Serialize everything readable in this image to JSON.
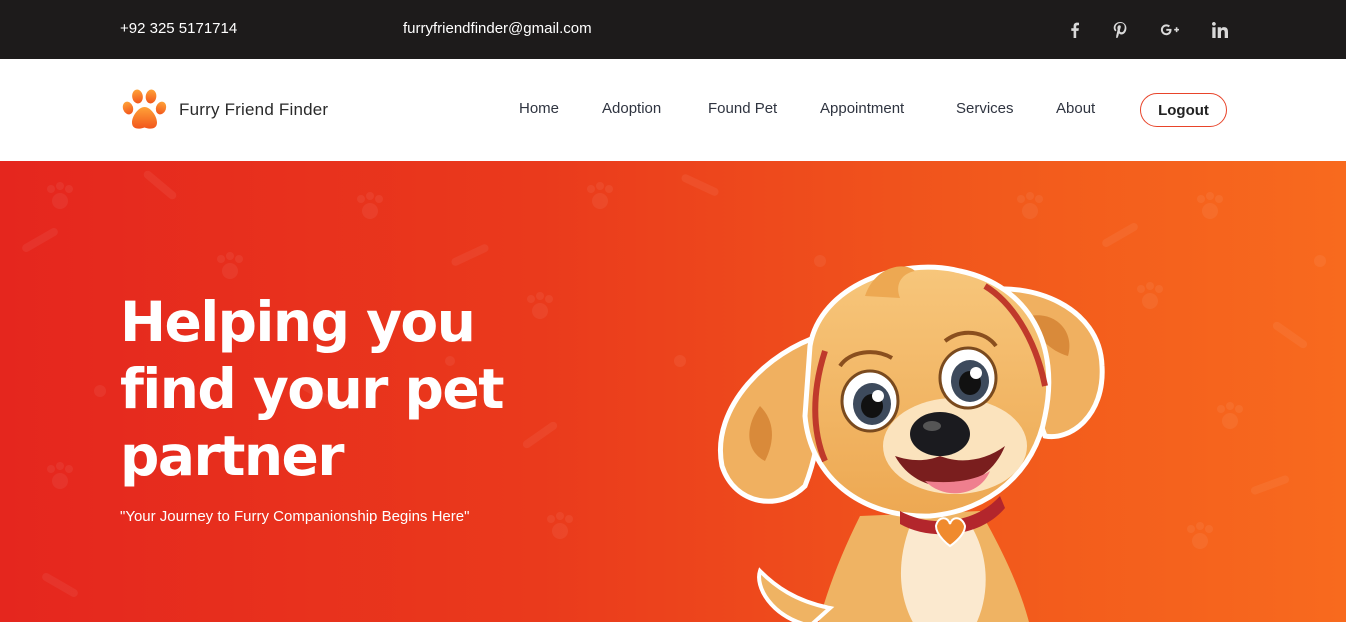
{
  "topbar": {
    "phone": "+92 325 5171714",
    "email": "furryfriendfinder@gmail.com",
    "social": [
      "facebook-icon",
      "pinterest-icon",
      "google-plus-icon",
      "linkedin-icon"
    ]
  },
  "navbar": {
    "brand": "Furry Friend Finder",
    "links": [
      "Home",
      "Adoption",
      "Found Pet",
      "Appointment",
      "Services",
      "About"
    ],
    "logout_label": "Logout"
  },
  "hero": {
    "title_line1": "Helping you",
    "title_line2": "find your pet",
    "title_line3": "partner",
    "subtitle": "\"Your Journey to Furry Companionship Begins Here\""
  },
  "colors": {
    "topbar_bg": "#1d1b1b",
    "accent": "#e8442a",
    "hero_gradient_start": "#e5261e",
    "hero_gradient_end": "#f86a1e"
  }
}
